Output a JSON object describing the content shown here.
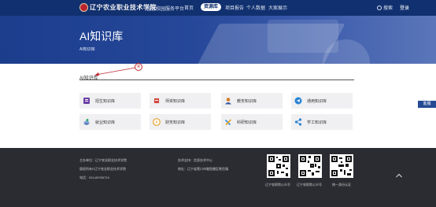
{
  "nav": {
    "school_name": "辽宁农业职业技术学院",
    "subtitle": "智慧校园服务平台",
    "items": [
      {
        "label": "首页"
      },
      {
        "label": "平台简介"
      },
      {
        "label": "项目报告"
      },
      {
        "label": "个人数据"
      },
      {
        "label": "大家展示"
      }
    ],
    "active_label": "资源库",
    "search_label": "搜索",
    "login_label": "登录"
  },
  "banner": {
    "title": "AI知识库",
    "breadcrumb": "AI知识库"
  },
  "section": {
    "title": "AI知识库",
    "annotation_number": "④"
  },
  "cards": [
    {
      "label": "招生知识库",
      "icon": "document-icon",
      "color": "#6b3fa6"
    },
    {
      "label": "师资知识库",
      "icon": "folder-icon",
      "color": "#d6463f"
    },
    {
      "label": "教务知识库",
      "icon": "user-icon",
      "color": "#d47c25"
    },
    {
      "label": "通用知识库",
      "icon": "send-icon",
      "color": "#2a84d4"
    },
    {
      "label": "就业知识库",
      "icon": "book-icon",
      "color": "#4b73b4"
    },
    {
      "label": "财务知识库",
      "icon": "coin-icon",
      "color": "#e8a227"
    },
    {
      "label": "科研知识库",
      "icon": "tools-icon",
      "color": "#2f8de0"
    },
    {
      "label": "学工知识库",
      "icon": "share-icon",
      "color": "#2a84d4"
    }
  ],
  "side_tab": "客服",
  "footer": {
    "left": [
      "主办单位：辽宁农业职业技术学院",
      "版权所有©辽宁农业职业技术学院",
      "电话：024-89765710"
    ],
    "mid": [
      "技术支持：信息技术中心",
      "地址：辽宁省营口市鲅鱼圈区熊岳镇",
      ""
    ],
    "qrs": [
      {
        "caption": "辽宁农职院公众号"
      },
      {
        "caption": "辽宁农职院公众号"
      },
      {
        "caption": "统一身份认证"
      }
    ]
  }
}
